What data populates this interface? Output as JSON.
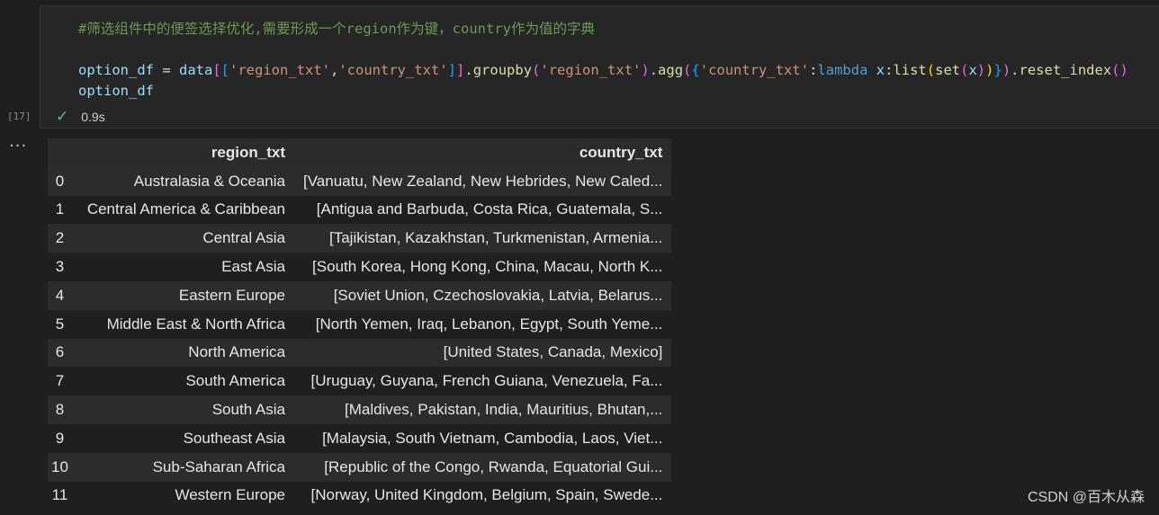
{
  "cell": {
    "comment": "#筛选组件中的便签选择优化,需要形成一个region作为键，country作为值的字典",
    "code_line2": "option_df",
    "exec_count": "[17]",
    "exec_time": "0.9s",
    "more_label": "···"
  },
  "table": {
    "headers": [
      "",
      "region_txt",
      "country_txt"
    ],
    "rows": [
      [
        "0",
        "Australasia & Oceania",
        "[Vanuatu, New Zealand, New Hebrides, New Caled..."
      ],
      [
        "1",
        "Central America & Caribbean",
        "[Antigua and Barbuda, Costa Rica, Guatemala, S..."
      ],
      [
        "2",
        "Central Asia",
        "[Tajikistan, Kazakhstan, Turkmenistan, Armenia..."
      ],
      [
        "3",
        "East Asia",
        "[South Korea, Hong Kong, China, Macau, North K..."
      ],
      [
        "4",
        "Eastern Europe",
        "[Soviet Union, Czechoslovakia, Latvia, Belarus..."
      ],
      [
        "5",
        "Middle East & North Africa",
        "[North Yemen, Iraq, Lebanon, Egypt, South Yeme..."
      ],
      [
        "6",
        "North America",
        "[United States, Canada, Mexico]"
      ],
      [
        "7",
        "South America",
        "[Uruguay, Guyana, French Guiana, Venezuela, Fa..."
      ],
      [
        "8",
        "South Asia",
        "[Maldives, Pakistan, India, Mauritius, Bhutan,..."
      ],
      [
        "9",
        "Southeast Asia",
        "[Malaysia, South Vietnam, Cambodia, Laos, Viet..."
      ],
      [
        "10",
        "Sub-Saharan Africa",
        "[Republic of the Congo, Rwanda, Equatorial Gui..."
      ],
      [
        "11",
        "Western Europe",
        "[Norway, United Kingdom, Belgium, Spain, Swede..."
      ]
    ]
  },
  "watermark": "CSDN @百木从森"
}
